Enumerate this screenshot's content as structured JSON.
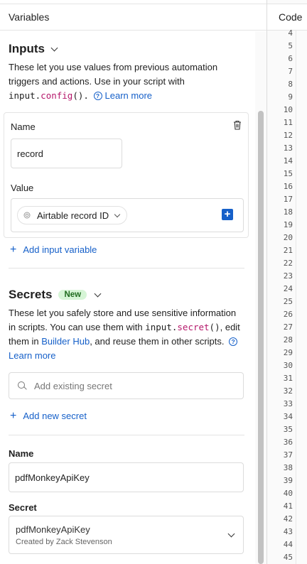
{
  "panel": {
    "title": "Variables"
  },
  "code": {
    "title": "Code",
    "line_numbers": [
      "4",
      "5",
      "6",
      "7",
      "8",
      "9",
      "10",
      "11",
      "12",
      "13",
      "14",
      "15",
      "16",
      "17",
      "18",
      "19",
      "20",
      "21",
      "22",
      "23",
      "24",
      "25",
      "26",
      "27",
      "28",
      "29",
      "30",
      "31",
      "32",
      "33",
      "34",
      "35",
      "36",
      "37",
      "38",
      "39",
      "40",
      "41",
      "42",
      "43",
      "44",
      "45"
    ]
  },
  "inputs": {
    "title": "Inputs",
    "desc_part1": "These let you use values from previous automation triggers and actions. Use in your script with ",
    "code_obj": "input",
    "code_dot": ".",
    "code_method": "config",
    "code_parens": "().",
    "learn_more": "Learn more",
    "name_label": "Name",
    "name_value": "record",
    "value_label": "Value",
    "value_pill": "Airtable record ID",
    "add_label": "Add input variable"
  },
  "secrets": {
    "title": "Secrets",
    "badge": "New",
    "desc_part1": "These let you safely store and use sensitive information in scripts. You can use them with ",
    "code_obj": "input",
    "code_dot": ".",
    "code_method": "secret",
    "code_parens": "()",
    "desc_part2": ", edit them in ",
    "builder_hub": "Builder Hub",
    "desc_part3": ", and reuse them in other scripts.",
    "learn_more": "Learn more",
    "search_placeholder": "Add existing secret",
    "add_label": "Add new secret",
    "name_label": "Name",
    "name_value": "pdfMonkeyApiKey",
    "secret_label": "Secret",
    "secret_value": "pdfMonkeyApiKey",
    "secret_creator": "Created by Zack Stevenson"
  },
  "colors": {
    "accent": "#1660c9",
    "badge_bg": "#d6f5d6",
    "badge_text": "#1e6b1e",
    "code_accent": "#b5186b"
  },
  "icons": [
    "chevron-down-icon",
    "help-icon",
    "trash-icon",
    "plus-square-icon",
    "plus-icon",
    "search-icon",
    "record-id-icon"
  ]
}
